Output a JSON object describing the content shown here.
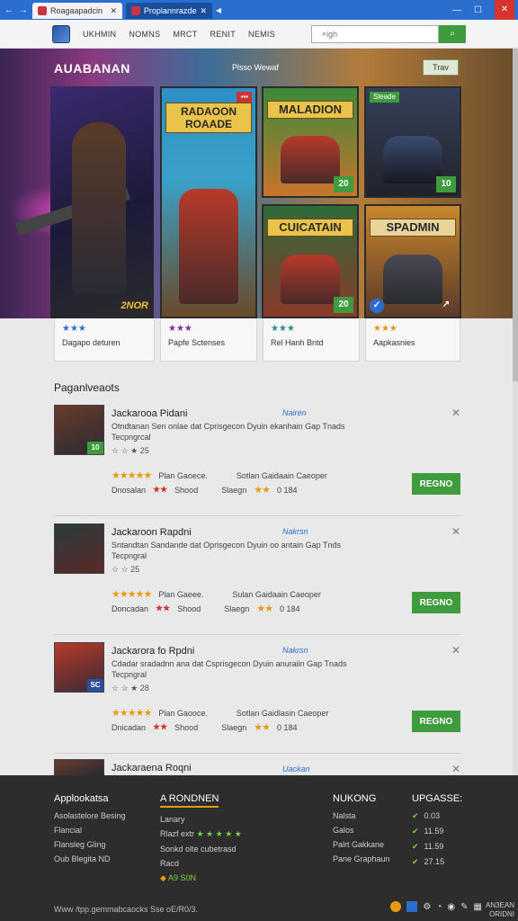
{
  "browser": {
    "tabs": [
      {
        "label": "Roagaapadcin",
        "active": true
      },
      {
        "label": "Proplannrazde",
        "active": false
      }
    ]
  },
  "header": {
    "nav": [
      "UKHMIN",
      "NOMNS",
      "MRCT",
      "RENIT",
      "NEMIS"
    ],
    "search_placeholder": "igh"
  },
  "hero": {
    "title": "AUABANAN",
    "subtitle": "Plsso Wewaf",
    "button": "Trav",
    "main_badge": "2NOR",
    "cards": [
      {
        "title": "RADAOON\nROAADE"
      },
      {
        "title": "MALADION",
        "stamp": "20"
      },
      {
        "title": "",
        "stamp": "10",
        "tag": "Sleade"
      },
      {
        "title": "CUICATAIN",
        "stamp": "20"
      },
      {
        "title": "SPADMIN"
      }
    ]
  },
  "card_info": [
    {
      "stars": "★★★",
      "label": "Dagapo deturen",
      "color": "#2a6fcf"
    },
    {
      "stars": "★★★",
      "label": "Papfe Sctenses",
      "color": "#7b2fa0"
    },
    {
      "stars": "★★★",
      "label": "Rel Hanh Bntd",
      "color": "#2a8c8c"
    },
    {
      "stars": "★★★",
      "label": "Aapkasnies",
      "color": "#e69a12"
    }
  ],
  "popular": {
    "title": "Paganlveaots",
    "items": [
      {
        "title": "Jackarooa Pidani",
        "category": "Nairen",
        "desc": "Otndtanan Sen onlae dat Cprisgecon Dyuin ekanhain Gap Tnads Tecpngrcal",
        "social": "☆ ☆ ★ 25",
        "row1a": "Plan Gaoece.",
        "row1b": "Sotlan Gaidaain Caeoper",
        "row2a": "Dnosalan",
        "row2b": "Shood",
        "row2c": "Slaegn",
        "row2d": "0 184",
        "button": "REGNO",
        "thumb_num": "10"
      },
      {
        "title": "Jackaroon Rapdni",
        "category": "Nakrsn",
        "desc": "Sntandtan Sandande dat Oprisgecon Dyuin oo antain Gap Tnds Tecpngral",
        "social": "☆ ☆ 25",
        "row1a": "Plan Gaeee.",
        "row1b": "Sulan Gaidaain Caeoper",
        "row2a": "Doncadan",
        "row2b": "Shood",
        "row2c": "Slaegn",
        "row2d": "0 184",
        "button": "REGNO",
        "thumb_num": ""
      },
      {
        "title": "Jackarora fo Rpdni",
        "category": "Nakrsn",
        "desc": "Cdadar sradadnn ana dat Csprisgecon Dyuin anuraiin Gap Tnads Tecpngral",
        "social": "☆ ☆ ★ 28",
        "row1a": "Plan Gaooce.",
        "row1b": "Sotlan Gaidlasin Caeoper",
        "row2a": "Dnicadan",
        "row2b": "Shood",
        "row2c": "Slaegn",
        "row2d": "0 184",
        "button": "REGNO",
        "thumb_num": "SC"
      }
    ],
    "partial_title": "Jackaraena Roqni",
    "partial_category": "Uackan"
  },
  "footer": {
    "col1_title": "Applookatsa",
    "col1_links": [
      "Asolastelore Besing",
      "Flancial",
      "Flansleg Gling",
      "Oub Blegita ND"
    ],
    "col2_title": "A RONDNEN",
    "col2_l1": "Lanary",
    "col2_l2": "Rlazf extr",
    "col2_l3": "Sonkd olte cubetrasd",
    "col2_l4": "Racd",
    "col2_l5": "A9 S0N",
    "col3_title": "NUKONG",
    "col3_links": [
      "Nalsta",
      "Galos",
      "Palrt Gakkane",
      "Pane Graphaun"
    ],
    "col4_title": "UPGASSE:",
    "col4_links": [
      "0.03",
      "11.59",
      "11.59",
      "27.15"
    ],
    "copyright": "Www /tpp.gemmabcaocks   Sse oE/R0/3.",
    "meta": [
      "AN3EAN",
      "ORIDNI"
    ]
  }
}
